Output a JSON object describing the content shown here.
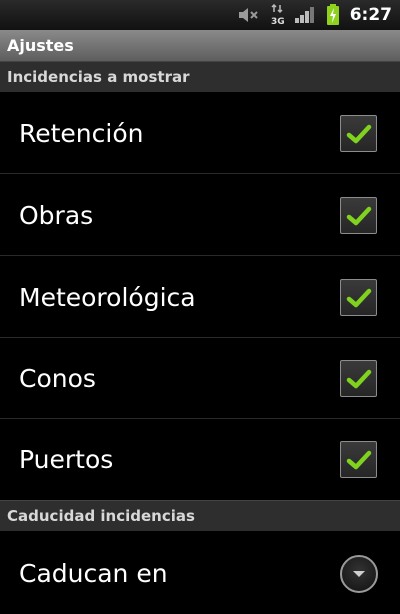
{
  "status_bar": {
    "time": "6:27",
    "icons": [
      "mute-icon",
      "data-3g-icon",
      "signal-icon",
      "battery-charging-icon"
    ],
    "colors": {
      "battery": "#8ed21e"
    }
  },
  "title_bar": {
    "title": "Ajustes"
  },
  "sections": [
    {
      "header": "Incidencias a mostrar",
      "items": [
        {
          "label": "Retención",
          "checked": true
        },
        {
          "label": "Obras",
          "checked": true
        },
        {
          "label": "Meteorológica",
          "checked": true
        },
        {
          "label": "Conos",
          "checked": true
        },
        {
          "label": "Puertos",
          "checked": true
        }
      ]
    },
    {
      "header": "Caducidad incidencias",
      "items": [
        {
          "label": "Caducan en",
          "control": "dropdown"
        }
      ]
    }
  ],
  "colors": {
    "check": "#7fd31e",
    "background": "#000000",
    "section_header": "#2e2e2e"
  }
}
